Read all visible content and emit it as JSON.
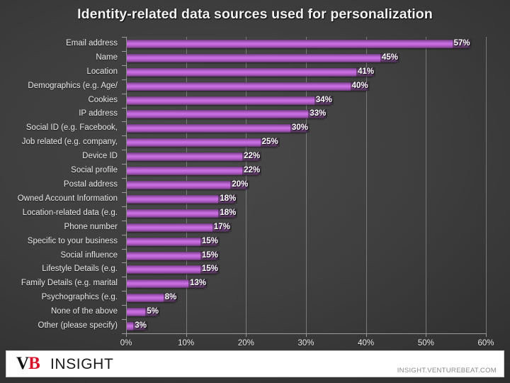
{
  "chart_data": {
    "type": "bar",
    "orientation": "horizontal",
    "title": "Identity-related data sources used for personalization",
    "xlabel": "",
    "ylabel": "",
    "xlim": [
      0,
      60
    ],
    "xticks": [
      "0%",
      "10%",
      "20%",
      "30%",
      "40%",
      "50%",
      "60%"
    ],
    "xtick_values": [
      0,
      10,
      20,
      30,
      40,
      50,
      60
    ],
    "grid": "vertical",
    "legend": "none",
    "categories": [
      "Email address",
      "Name",
      "Location",
      "Demographics (e.g. Age/",
      "Cookies",
      "IP address",
      "Social ID (e.g. Facebook,",
      "Job related (e.g. company,",
      "Device ID",
      "Social profile",
      "Postal address",
      "Owned Account Information",
      "Location-related data (e.g.",
      "Phone number",
      "Specific to your business",
      "Social influence",
      "Lifestyle Details (e.g.",
      "Family Details (e.g. marital",
      "Psychographics (e.g.",
      "None of the above",
      "Other (please specify)"
    ],
    "values": [
      57,
      45,
      41,
      40,
      34,
      33,
      30,
      25,
      22,
      22,
      20,
      18,
      18,
      17,
      15,
      15,
      15,
      13,
      8,
      5,
      3
    ],
    "value_labels": [
      "57%",
      "45%",
      "41%",
      "40%",
      "34%",
      "33%",
      "30%",
      "25%",
      "22%",
      "22%",
      "20%",
      "18%",
      "18%",
      "17%",
      "15%",
      "15%",
      "15%",
      "13%",
      "8%",
      "5%",
      "3%"
    ],
    "colors": {
      "bar_light": "#c96fe0",
      "bar_dark": "#6d3b7e",
      "background": "#3a3a3a",
      "gridline": "#8e8e8e",
      "text": "#ededed"
    }
  },
  "footer": {
    "logo_v": "V",
    "logo_b": "B",
    "logo_word": "INSIGHT",
    "url": "INSIGHT.VENTUREBEAT.COM"
  }
}
